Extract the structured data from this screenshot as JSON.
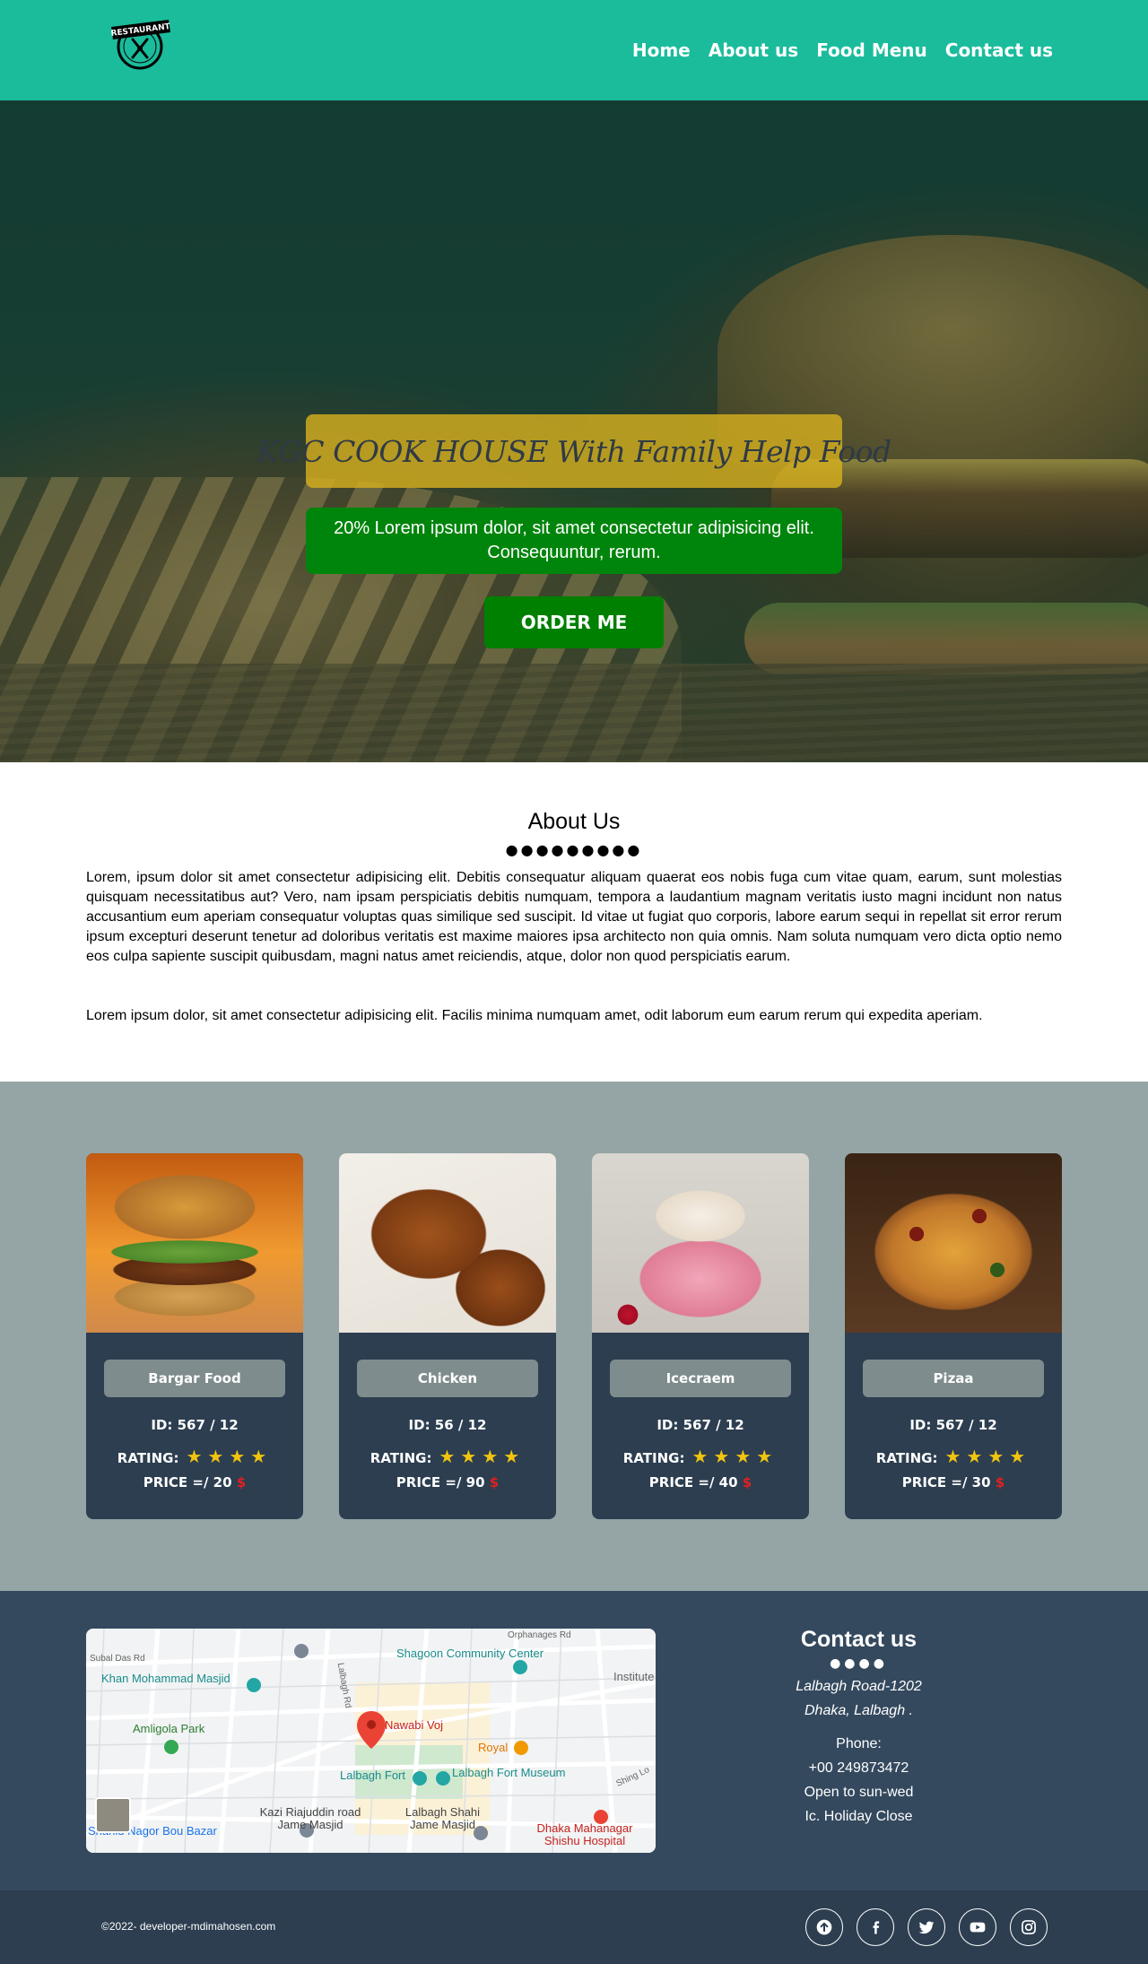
{
  "header": {
    "logo_text": "RESTAURANT",
    "nav": [
      "Home",
      "About us",
      "Food Menu",
      "Contact us"
    ]
  },
  "hero": {
    "title": "KGC COOK HOUSE With Family Help Food",
    "subtitle": "20% Lorem ipsum dolor, sit amet consectetur adipisicing elit. Consequuntur, rerum.",
    "button": "ORDER ME"
  },
  "about": {
    "title": "About Us",
    "dots": "●●●●●●●●●",
    "paragraphs": [
      "Lorem, ipsum dolor sit amet consectetur adipisicing elit. Debitis consequatur aliquam quaerat eos nobis fuga cum vitae quam, earum, sunt molestias quisquam necessitatibus aut? Vero, nam ipsam perspiciatis debitis numquam, tempora a laudantium magnam veritatis iusto magni incidunt non natus accusantium eum aperiam consequatur voluptas quas similique sed suscipit. Id vitae ut fugiat quo corporis, labore earum sequi in repellat sit error rerum ipsum excepturi deserunt tenetur ad doloribus veritatis est maxime maiores ipsa architecto non quia omnis. Nam soluta numquam vero dicta optio nemo eos culpa sapiente suscipit quibusdam, magni natus amet reiciendis, atque, dolor non quod perspiciatis earum.",
      "Lorem ipsum dolor, sit amet consectetur adipisicing elit. Facilis minima numquam amet, odit laborum eum earum rerum qui expedita aperiam."
    ]
  },
  "menu": {
    "cards": [
      {
        "name": "Bargar Food",
        "id": "ID: 567 / 12",
        "rating_label": "RATING:",
        "stars": "★★★★",
        "price": "PRICE =/ 20",
        "currency": "$"
      },
      {
        "name": "Chicken",
        "id": "ID: 56 / 12",
        "rating_label": "RATING:",
        "stars": "★★★★",
        "price": "PRICE =/ 90",
        "currency": "$"
      },
      {
        "name": "Icecraem",
        "id": "ID: 567 / 12",
        "rating_label": "RATING:",
        "stars": "★★★★",
        "price": "PRICE =/ 40",
        "currency": "$"
      },
      {
        "name": "Pizaa",
        "id": "ID: 567 / 12",
        "rating_label": "RATING:",
        "stars": "★★★★",
        "price": "PRICE =/ 30",
        "currency": "$"
      }
    ]
  },
  "map": {
    "labels": [
      "Shagoon Community Center",
      "Khan Mohammad Masjid",
      "Amligola Park",
      "Nawabi Voj",
      "Royal",
      "Lalbagh Fort",
      "Lalbagh Fort Museum",
      "Kazi Riajuddin road Jame Masjid",
      "Lalbagh Shahi Jame Masjid",
      "Shahid Nagor Bou Bazar",
      "Dhaka Mahanagar Shishu Hospital",
      "Orphanages Rd",
      "Lalbagh Rd",
      "Subal Das Rd",
      "Institute",
      "Shing Lo"
    ]
  },
  "contact": {
    "title": "Contact us",
    "dots": "●●●●",
    "address": [
      "Lalbagh Road-1202",
      "Dhaka, Lalbagh ."
    ],
    "phone_label": "Phone:",
    "phone": "+00 249873472",
    "hours": "Open to sun-wed",
    "holiday": "Ic. Holiday Close"
  },
  "footer": {
    "copyright": "©2022- developer-mdimahosen.com",
    "socials": [
      "arrow-up-icon",
      "facebook-icon",
      "twitter-icon",
      "youtube-icon",
      "instagram-icon"
    ]
  },
  "colors": {
    "header": "#1abc9c",
    "hero_title_bg": "#d4af1e",
    "hero_button": "#008000",
    "menu_bg": "#95a5a6",
    "card_bg": "#2c3e50",
    "card_button": "#7f8c8d",
    "star": "#f1c40f",
    "price_dollar": "#e02020",
    "footer_bg": "#34495e"
  }
}
